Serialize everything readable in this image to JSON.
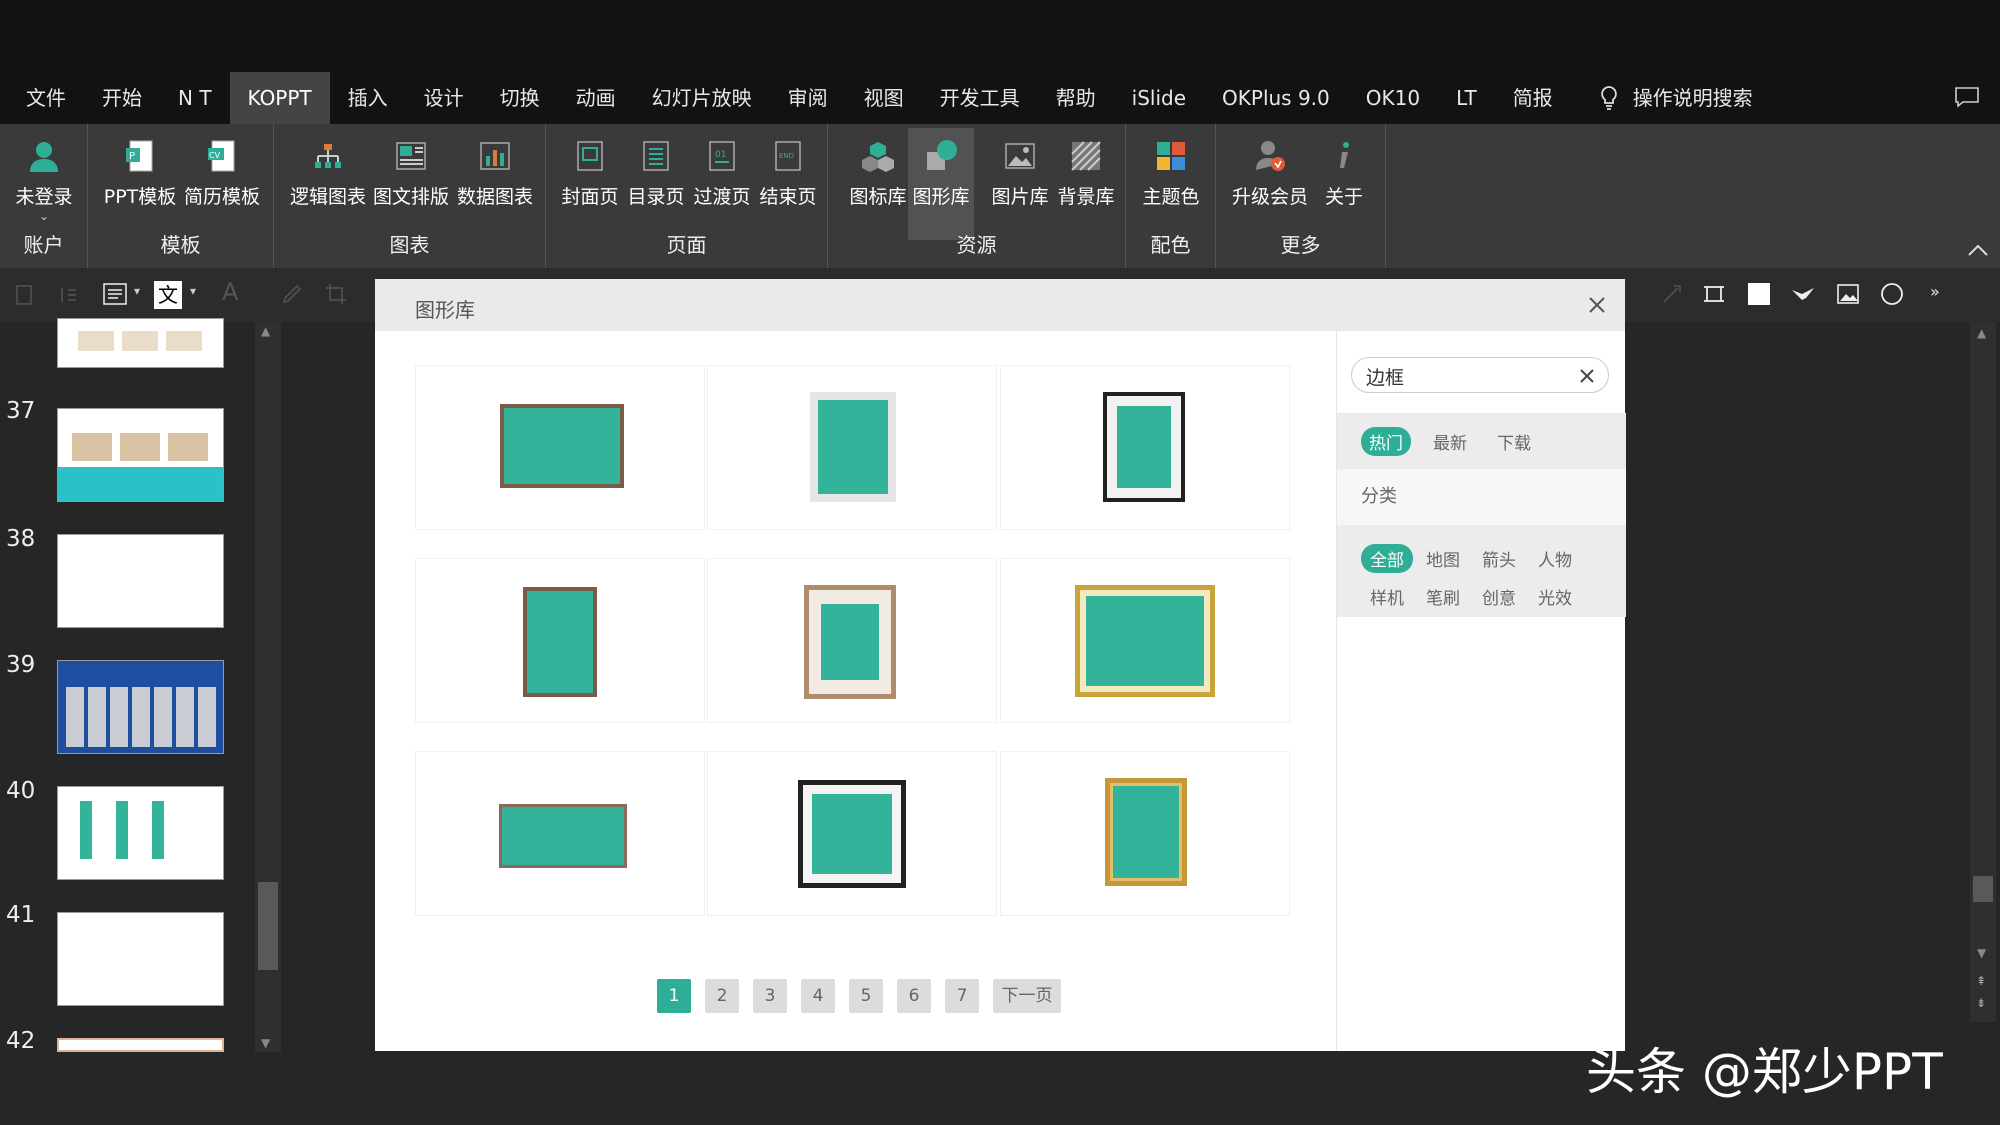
{
  "menu": {
    "tabs": [
      "文件",
      "开始",
      "N T",
      "KOPPT",
      "插入",
      "设计",
      "切换",
      "动画",
      "幻灯片放映",
      "审阅",
      "视图",
      "开发工具",
      "帮助",
      "iSlide",
      "OKPlus 9.0",
      "OK10",
      "LT",
      "简报"
    ],
    "active_tab": "KOPPT",
    "search_label": "操作说明搜索"
  },
  "ribbon": {
    "groups": [
      {
        "label": "账户",
        "buttons": [
          "未登录"
        ]
      },
      {
        "label": "模板",
        "buttons": [
          "PPT模板",
          "简历模板"
        ]
      },
      {
        "label": "图表",
        "buttons": [
          "逻辑图表",
          "图文排版",
          "数据图表"
        ]
      },
      {
        "label": "页面",
        "buttons": [
          "封面页",
          "目录页",
          "过渡页",
          "结束页"
        ]
      },
      {
        "label": "资源",
        "buttons": [
          "图标库",
          "图形库",
          "图片库",
          "背景库"
        ]
      },
      {
        "label": "配色",
        "buttons": [
          "主题色"
        ]
      },
      {
        "label": "更多",
        "buttons": [
          "升级会员",
          "关于"
        ]
      }
    ],
    "selected_button": "图形库"
  },
  "slides": {
    "numbers": [
      "37",
      "38",
      "39",
      "40",
      "41",
      "42"
    ]
  },
  "dialog": {
    "title": "图形库",
    "search": {
      "value": "边框"
    },
    "sort_tabs": [
      "热门",
      "最新",
      "下载"
    ],
    "active_sort": "热门",
    "category_label": "分类",
    "categories": [
      "全部",
      "地图",
      "箭头",
      "人物",
      "样机",
      "笔刷",
      "创意",
      "光效"
    ],
    "active_category": "全部",
    "pagination": {
      "pages": [
        "1",
        "2",
        "3",
        "4",
        "5",
        "6",
        "7"
      ],
      "current": "1",
      "next_label": "下一页"
    },
    "accent_color": "#2fae97",
    "fill_color": "#34b39b"
  },
  "watermark": "头条 @郑少PPT"
}
